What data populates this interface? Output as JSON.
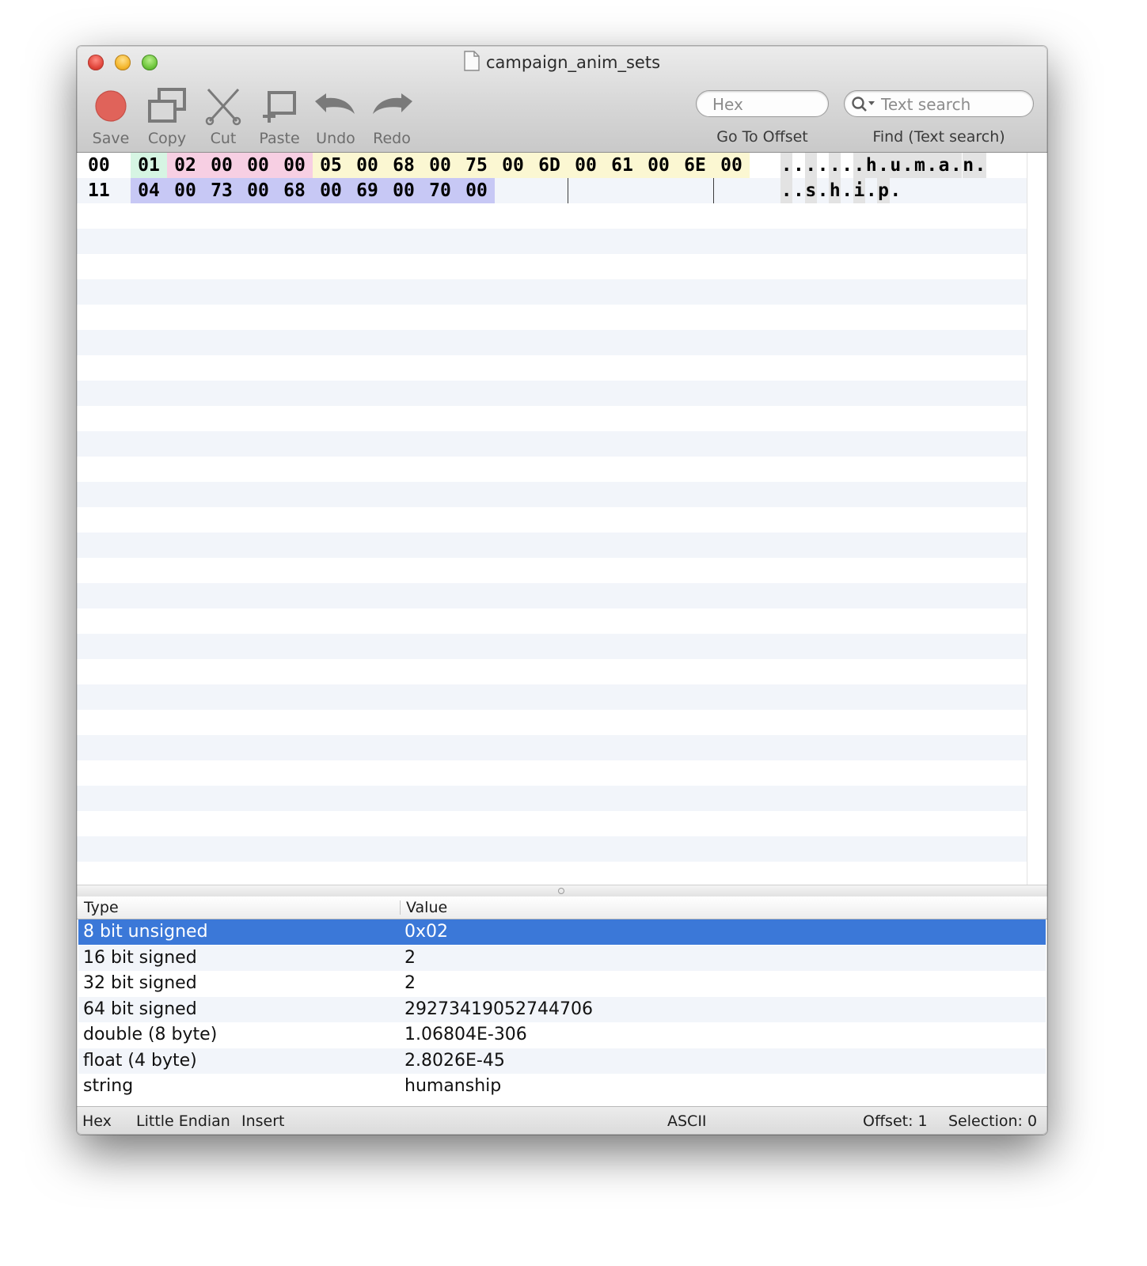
{
  "window": {
    "title": "campaign_anim_sets"
  },
  "toolbar": {
    "save": "Save",
    "copy": "Copy",
    "cut": "Cut",
    "paste": "Paste",
    "undo": "Undo",
    "redo": "Redo",
    "offset_placeholder": "Hex",
    "offset_label": "Go To Offset",
    "search_placeholder": "Text search",
    "search_label": "Find (Text search)"
  },
  "colors": {
    "selection": "#3b78d8",
    "highlight_green": "#d6f5e3",
    "highlight_pink": "#f7cfe3",
    "highlight_yellow": "#fbf7d2",
    "highlight_lavender": "#c7c8f5",
    "ascii_gray": "#e3e3e3"
  },
  "hex": {
    "rows": [
      {
        "offset": "00",
        "bytes": [
          "01",
          "02",
          "00",
          "00",
          "00",
          "05",
          "00",
          "68",
          "00",
          "75",
          "00",
          "6D",
          "00",
          "61",
          "00",
          "6E",
          "00"
        ],
        "ascii": [
          ".",
          ".",
          ".",
          ".",
          ".",
          ".",
          ".",
          "h",
          ".",
          "u",
          ".",
          "m",
          ".",
          "a",
          ".",
          "n",
          "."
        ]
      },
      {
        "offset": "11",
        "bytes": [
          "04",
          "00",
          "73",
          "00",
          "68",
          "00",
          "69",
          "00",
          "70",
          "00"
        ],
        "ascii": [
          ".",
          ".",
          "s",
          ".",
          "h",
          ".",
          "i",
          ".",
          "p",
          "."
        ]
      }
    ]
  },
  "inspector": {
    "col_type": "Type",
    "col_value": "Value",
    "rows": [
      {
        "type": "8 bit unsigned",
        "value": "0x02",
        "selected": true
      },
      {
        "type": "16 bit signed",
        "value": "2"
      },
      {
        "type": "32 bit signed",
        "value": "2"
      },
      {
        "type": "64 bit signed",
        "value": "29273419052744706"
      },
      {
        "type": "double (8 byte)",
        "value": "1.06804E-306"
      },
      {
        "type": "float (4 byte)",
        "value": "2.8026E-45"
      },
      {
        "type": "string",
        "value": "humanship"
      }
    ]
  },
  "status": {
    "mode": "Hex",
    "endian": "Little Endian",
    "edit_mode": "Insert",
    "encoding": "ASCII",
    "offset": "Offset: 1",
    "selection": "Selection: 0"
  }
}
